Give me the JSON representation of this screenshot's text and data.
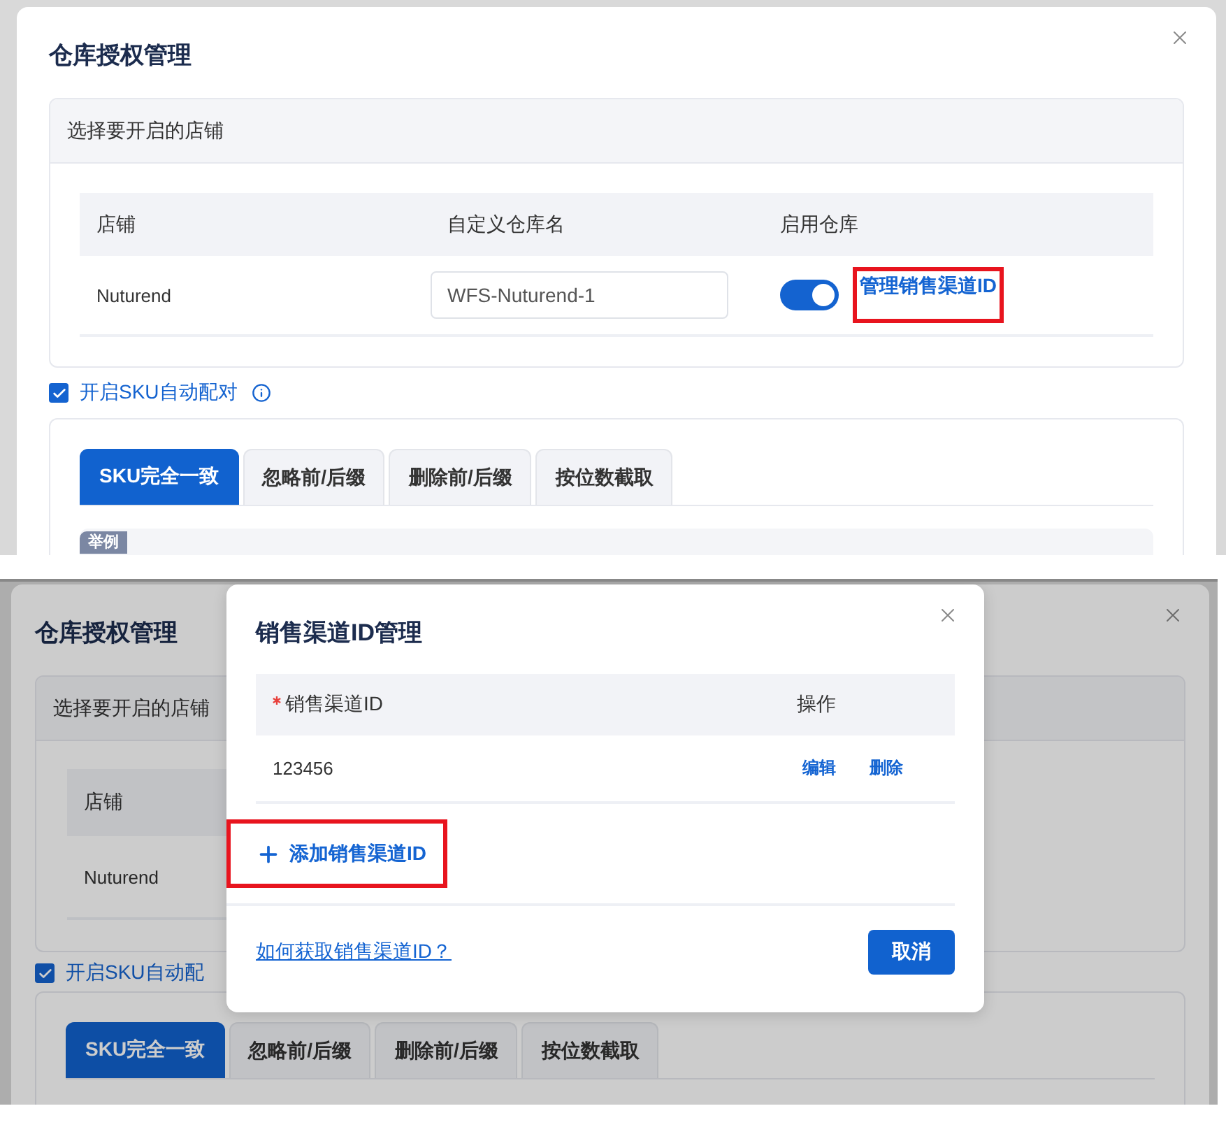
{
  "screens": [
    {
      "dialog": {
        "title": "仓库授权管理",
        "section_title": "选择要开启的店铺",
        "columns": [
          "店铺",
          "自定义仓库名",
          "启用仓库"
        ],
        "rows": [
          {
            "shop": "Nuturend",
            "warehouse_name": "WFS-Nuturend-1",
            "enabled": true,
            "link": "管理销售渠道ID",
            "link_highlighted": true
          }
        ],
        "auto_match": {
          "label": "开启SKU自动配对",
          "checked": true,
          "info": true
        },
        "tabs": [
          {
            "label": "SKU完全一致",
            "selected": true
          },
          {
            "label": "忽略前/后缀",
            "selected": false
          },
          {
            "label": "删除前/后缀",
            "selected": false
          },
          {
            "label": "按位数截取",
            "selected": false
          }
        ],
        "example_badge": "举例"
      }
    },
    {
      "dimmed": true,
      "dialog": {
        "title": "仓库授权管理",
        "section_title": "选择要开启的店铺",
        "columns": [
          "店铺"
        ],
        "rows": [
          {
            "shop": "Nuturend"
          }
        ],
        "auto_match": {
          "label": "开启SKU自动配",
          "checked": true
        },
        "tabs": [
          {
            "label": "SKU完全一致",
            "selected": true
          },
          {
            "label": "忽略前/后缀",
            "selected": false
          },
          {
            "label": "删除前/后缀",
            "selected": false
          },
          {
            "label": "按位数截取",
            "selected": false
          }
        ]
      },
      "sub_dialog": {
        "title": "销售渠道ID管理",
        "columns": [
          {
            "label": "销售渠道ID",
            "required": true
          },
          {
            "label": "操作"
          }
        ],
        "rows": [
          {
            "id": "123456",
            "actions": [
              "编辑",
              "删除"
            ]
          }
        ],
        "add_button": "添加销售渠道ID",
        "add_highlighted": true,
        "help_link": "如何获取销售渠道ID？",
        "cancel_button": "取消"
      }
    }
  ]
}
